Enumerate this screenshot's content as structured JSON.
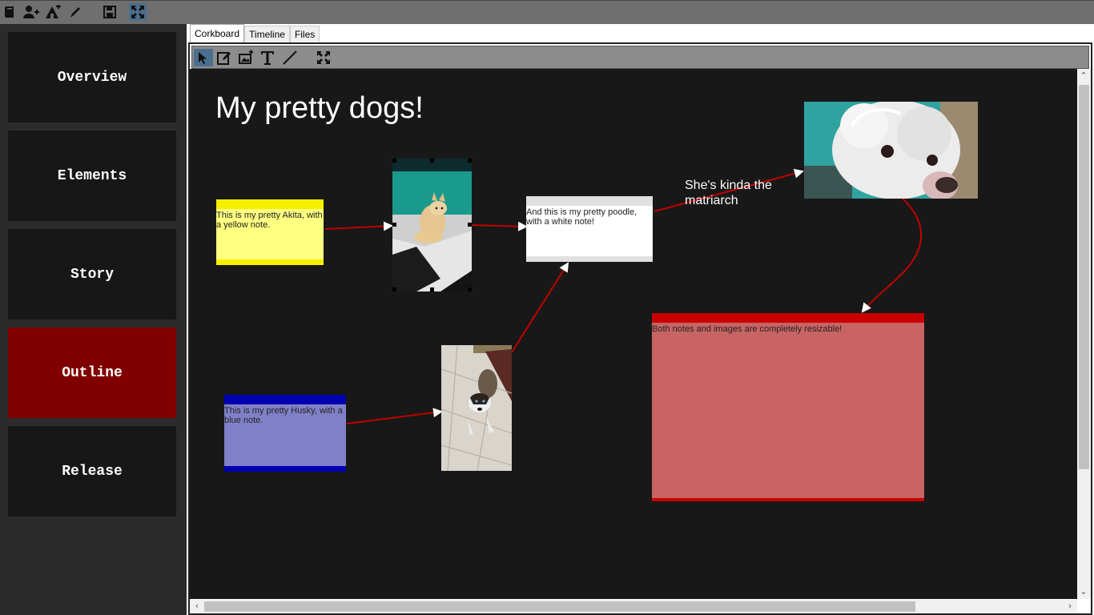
{
  "toolbar": {
    "icons": [
      "book-icon",
      "add-user-icon",
      "add-location-icon",
      "pen-icon",
      "save-icon",
      "fullscreen-icon"
    ]
  },
  "sidebar": {
    "items": [
      {
        "label": "Overview"
      },
      {
        "label": "Elements"
      },
      {
        "label": "Story"
      },
      {
        "label": "Outline",
        "selected": true
      },
      {
        "label": "Release"
      }
    ]
  },
  "tabs": [
    {
      "label": "Corkboard",
      "active": true
    },
    {
      "label": "Timeline"
    },
    {
      "label": "Files"
    }
  ],
  "board_toolbar": {
    "icons": [
      "pointer-icon",
      "edit-note-icon",
      "add-image-icon",
      "text-icon",
      "line-icon",
      "fullscreen-icon"
    ]
  },
  "board": {
    "title": "My pretty dogs!",
    "free_text": "She's kinda the matriarch",
    "notes": {
      "yellow": {
        "text": "This is my pretty Akita, with a yellow note.",
        "color": "#ffff80",
        "bar": "#f5f000"
      },
      "white": {
        "text": "And this is my pretty poodle, with a white note!",
        "color": "#ffffff",
        "bar": "#e0e0e0"
      },
      "blue": {
        "text": "This is my pretty Husky, with a blue note.",
        "color": "#8080c8",
        "bar": "#0000b0"
      },
      "red": {
        "text": "Both notes and images are completely resizable!",
        "color": "#c86464",
        "bar": "#c80000"
      }
    },
    "connector_color": "#c00000"
  }
}
